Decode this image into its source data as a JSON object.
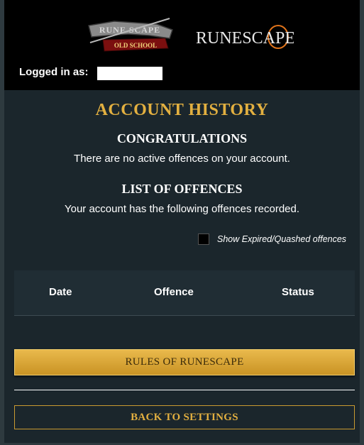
{
  "header": {
    "logo_osrs_top": "RUNE SCAPE",
    "logo_osrs_banner": "OLD SCHOOL",
    "logo_rs": "RUNESCAPE",
    "logged_in_label": "Logged in as:",
    "logged_in_value": ""
  },
  "main": {
    "title": "ACCOUNT HISTORY",
    "congrats_heading": "CONGRATULATIONS",
    "congrats_message": "There are no active offences on your account.",
    "list_heading": "LIST OF OFFENCES",
    "list_message": "Your account has the following offences recorded.",
    "show_expired_label": "Show Expired/Quashed offences",
    "show_expired_checked": false,
    "table": {
      "columns": [
        "Date",
        "Offence",
        "Status"
      ],
      "rows": []
    },
    "rules_button": "RULES OF RUNESCAPE",
    "back_button": "BACK TO SETTINGS"
  },
  "colors": {
    "background": "#1b262c",
    "header_bg": "#000000",
    "accent_gold": "#e3b040",
    "button_gold": "#d9a437"
  }
}
